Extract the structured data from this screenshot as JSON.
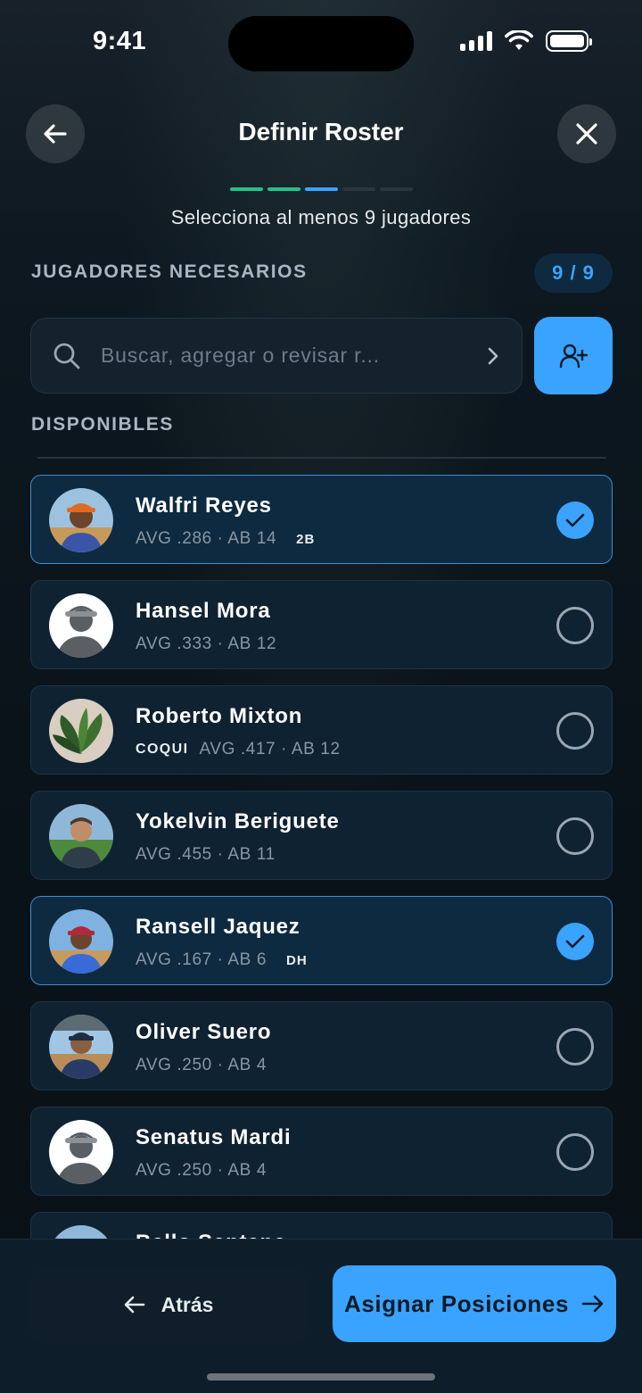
{
  "status": {
    "time": "9:41"
  },
  "header": {
    "title": "Definir Roster",
    "subtitle": "Selecciona al menos 9 jugadores",
    "progress_colors": [
      "#22c28a",
      "#22c28a",
      "#3aa3ff",
      "#2a3640",
      "#2a3640"
    ]
  },
  "needed": {
    "label": "JUGADORES NECESARIOS",
    "count": "9 / 9"
  },
  "search": {
    "placeholder": "Buscar, agregar o revisar r..."
  },
  "available_label": "DISPONIBLES",
  "players": [
    {
      "name": "Walfri Reyes",
      "team": "",
      "stats": "AVG .286 · AB 14",
      "position": "2B",
      "selected": true,
      "avatar": "photo-orange-cap"
    },
    {
      "name": "Hansel Mora",
      "team": "",
      "stats": "AVG .333 · AB 12",
      "position": "",
      "selected": false,
      "avatar": "placeholder"
    },
    {
      "name": "Roberto Mixton",
      "team": "COQUI",
      "stats": "AVG .417 · AB 12",
      "position": "",
      "selected": false,
      "avatar": "photo-plant"
    },
    {
      "name": "Yokelvin Beriguete",
      "team": "",
      "stats": "AVG .455 · AB 11",
      "position": "",
      "selected": false,
      "avatar": "photo-field"
    },
    {
      "name": "Ransell Jaquez",
      "team": "",
      "stats": "AVG .167 · AB 6",
      "position": "DH",
      "selected": true,
      "avatar": "photo-red-cap"
    },
    {
      "name": "Oliver Suero",
      "team": "",
      "stats": "AVG .250 · AB 4",
      "position": "",
      "selected": false,
      "avatar": "photo-dugout"
    },
    {
      "name": "Senatus Mardi",
      "team": "",
      "stats": "AVG .250 · AB 4",
      "position": "",
      "selected": false,
      "avatar": "placeholder"
    },
    {
      "name": "Bello Santana",
      "team": "",
      "stats": "",
      "position": "",
      "selected": false,
      "avatar": "photo-field"
    }
  ],
  "footer": {
    "back_label": "Atrás",
    "next_label": "Asignar Posiciones"
  }
}
